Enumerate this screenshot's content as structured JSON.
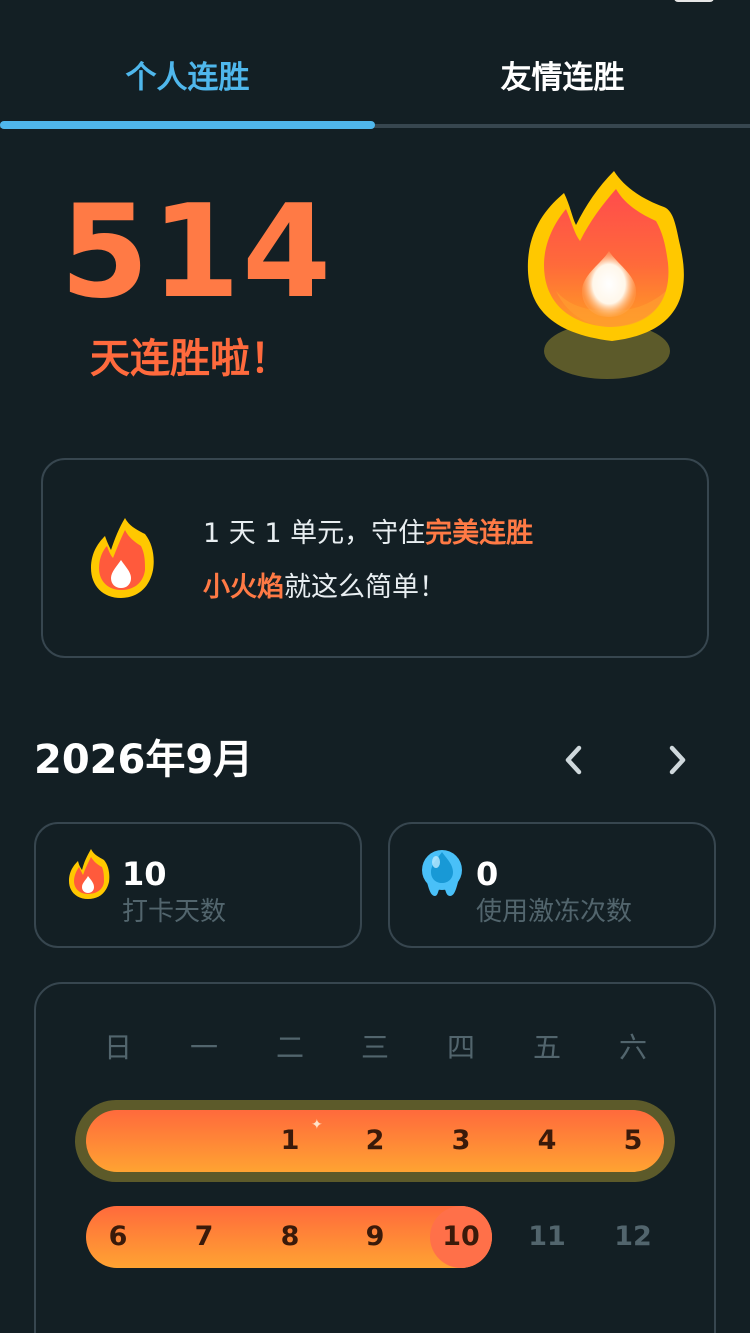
{
  "tabs": [
    {
      "label": "个人连胜",
      "active": true
    },
    {
      "label": "友情连胜",
      "active": false
    }
  ],
  "hero": {
    "streak_count": "514",
    "streak_label": "天连胜啦！"
  },
  "info_card": {
    "line1_prefix": "1 天 1 单元，守住",
    "line1_highlight": "完美连胜",
    "line2_highlight": "小火焰",
    "line2_suffix": "就这么简单！"
  },
  "calendar_header": {
    "month": "2026年9月",
    "prev_icon": "chevron-left-icon",
    "next_icon": "chevron-right-icon"
  },
  "stats": [
    {
      "value": "10",
      "label": "打卡天数",
      "icon": "flame-icon"
    },
    {
      "value": "0",
      "label": "使用激冻次数",
      "icon": "freeze-drop-icon"
    }
  ],
  "calendar": {
    "weekdays": [
      "日",
      "一",
      "二",
      "三",
      "四",
      "五",
      "六"
    ],
    "week1": [
      "1",
      "2",
      "3",
      "4",
      "5"
    ],
    "week2": [
      "6",
      "7",
      "8",
      "9",
      "10",
      "11",
      "12"
    ],
    "today": "10",
    "streak_days": [
      "1",
      "2",
      "3",
      "4",
      "5",
      "6",
      "7",
      "8",
      "9",
      "10"
    ]
  },
  "colors": {
    "background": "#131f24",
    "accent_blue": "#4fb7ec",
    "flame_orange": "#ff7a45",
    "border": "#37464f",
    "muted_text": "#52656d"
  }
}
